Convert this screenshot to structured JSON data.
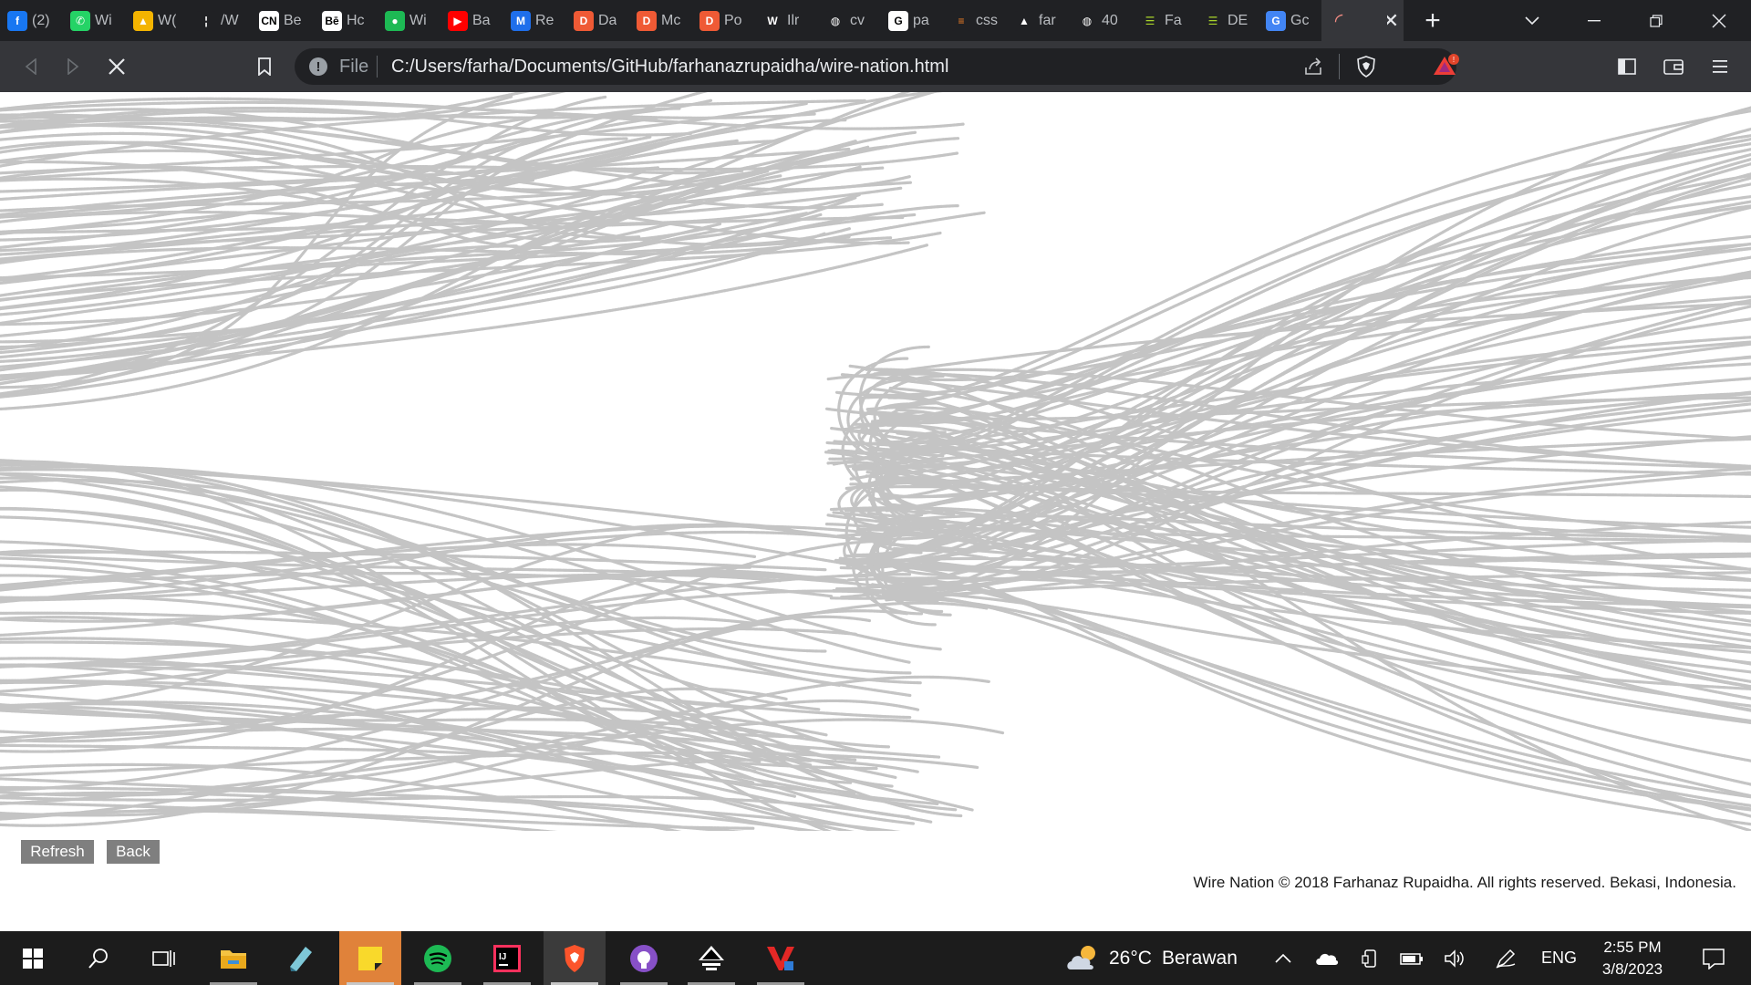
{
  "browser": {
    "tabs": [
      {
        "label": "(2)",
        "icon": "facebook-icon",
        "color": "#1877f2",
        "glyph": "f"
      },
      {
        "label": "Wi",
        "icon": "whatsapp-icon",
        "color": "#25d366",
        "glyph": "✆"
      },
      {
        "label": "W(",
        "icon": "google-drive-icon",
        "color": "#f4b400",
        "glyph": "▲"
      },
      {
        "label": "/W",
        "icon": "page-icon",
        "color": "#202124",
        "glyph": "¦"
      },
      {
        "label": "Be",
        "icon": "cnn-icon",
        "color": "#ffffff",
        "glyph": "CN"
      },
      {
        "label": "Hc",
        "icon": "behance-icon",
        "color": "#ffffff",
        "glyph": "Bē"
      },
      {
        "label": "Wi",
        "icon": "spotify-icon",
        "color": "#1db954",
        "glyph": "●"
      },
      {
        "label": "Ba",
        "icon": "youtube-icon",
        "color": "#ff0000",
        "glyph": "▶"
      },
      {
        "label": "Re",
        "icon": "mui-icon",
        "color": "#1f6feb",
        "glyph": "M"
      },
      {
        "label": "Da",
        "icon": "dribbble-icon",
        "color": "#ef5a35",
        "glyph": "D"
      },
      {
        "label": "Mc",
        "icon": "dribbble-icon",
        "color": "#ef5a35",
        "glyph": "D"
      },
      {
        "label": "Po",
        "icon": "dribbble-icon",
        "color": "#ef5a35",
        "glyph": "D"
      },
      {
        "label": "Ilr",
        "icon": "webflow-icon",
        "color": "#202124",
        "glyph": "W"
      },
      {
        "label": "cv",
        "icon": "globe-icon",
        "color": "#202124",
        "glyph": "◍"
      },
      {
        "label": "pa",
        "icon": "google-icon",
        "color": "#ffffff",
        "glyph": "G"
      },
      {
        "label": "css",
        "icon": "stackoverflow-icon",
        "color": "#202124",
        "glyph": "≡"
      },
      {
        "label": "far",
        "icon": "vercel-icon",
        "color": "#202124",
        "glyph": "▲"
      },
      {
        "label": "40",
        "icon": "globe-icon",
        "color": "#202124",
        "glyph": "◍"
      },
      {
        "label": "Fa",
        "icon": "green-bars-icon",
        "color": "#202124",
        "glyph": "☰"
      },
      {
        "label": "DE",
        "icon": "green-bars-icon",
        "color": "#202124",
        "glyph": "☰"
      },
      {
        "label": "Gc",
        "icon": "google-translate-icon",
        "color": "#4285f4",
        "glyph": "G"
      },
      {
        "label": "",
        "icon": "loading-spinner-icon",
        "color": "#35363a",
        "glyph": "◜",
        "active": true
      }
    ],
    "new_tab": "+",
    "address": {
      "scheme": "File",
      "url": "C:/Users/farha/Documents/GitHub/farhanazrupaidha/wire-nation.html"
    }
  },
  "page": {
    "refresh_label": "Refresh",
    "back_label": "Back",
    "footer": "Wire Nation © 2018 Farhanaz Rupaidha. All rights reserved. Bekasi, Indonesia.",
    "wire_color": "#c4c4c4"
  },
  "taskbar": {
    "weather_temp": "26°C",
    "weather_desc": "Berawan",
    "language": "ENG",
    "time": "2:55 PM",
    "date": "3/8/2023"
  }
}
